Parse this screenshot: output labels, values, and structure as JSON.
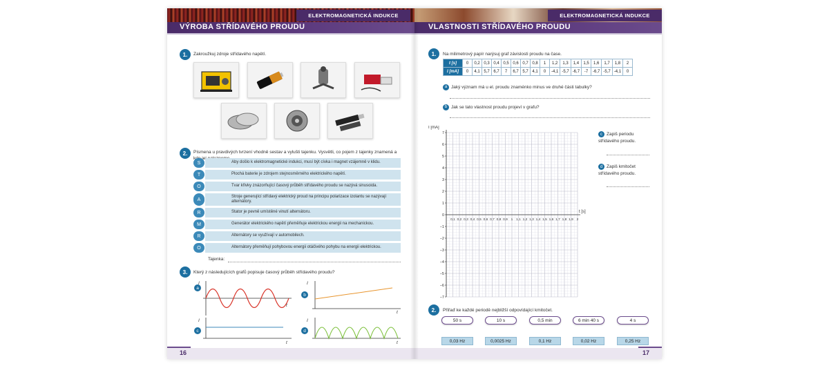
{
  "left_page": {
    "chapter": "ELEKTROMAGNETICKÁ INDUKCE",
    "title": "VÝROBA STŘÍDAVÉHO PROUDU",
    "page_number": "16",
    "task1": {
      "number": "1.",
      "text": "Zakroužkuj zdroje střídavého napětí."
    },
    "task1_photos": [
      "generator-icon",
      "battery-icon",
      "dynamo-icon",
      "power-bank-icon",
      "button-cell-icon",
      "alternator-icon",
      "usb-sticks-icon"
    ],
    "task2": {
      "number": "2.",
      "text": "Písmena u pravdivých tvrzení vhodně sestav a vylušti tajenku. Vysvětli, co pojem z tajenky znamená a kde jej nalezneme."
    },
    "statements": [
      {
        "letter": "S",
        "text": "Aby došlo k elektromagnetické indukci, musí být cívka i magnet vzájemně v klidu."
      },
      {
        "letter": "T",
        "text": "Plochá baterie je zdrojem stejnosměrného elektrického napětí."
      },
      {
        "letter": "O",
        "text": "Tvar křivky znázorňující časový průběh střídavého proudu se nazývá sinusoida."
      },
      {
        "letter": "A",
        "text": "Stroje generující střídavý elektrický proud na principu polarizace izolantu se nazývají alternátory."
      },
      {
        "letter": "R",
        "text": "Stator je pevně umístěné vinutí alternátoru."
      },
      {
        "letter": "M",
        "text": "Generátor elektrického napětí přeměňuje elektrickou energii na mechanickou."
      },
      {
        "letter": "R",
        "text": "Alternátory se využívají v automobilech."
      },
      {
        "letter": "O",
        "text": "Alternátory přeměňují pohybovou energii otáčivého pohybu na energii elektrickou."
      }
    ],
    "tajenka_label": "Tajenka:",
    "task3": {
      "number": "3.",
      "text": "Který z následujících grafů popisuje časový průběh střídavého proudu?"
    },
    "graphs": [
      {
        "label": "a",
        "ylabel": "I",
        "xlabel": "t"
      },
      {
        "label": "b",
        "ylabel": "I",
        "xlabel": "t"
      },
      {
        "label": "c",
        "ylabel": "I",
        "xlabel": "t"
      },
      {
        "label": "d",
        "ylabel": "I",
        "xlabel": "t"
      }
    ]
  },
  "right_page": {
    "chapter": "ELEKTROMAGNETICKÁ INDUKCE",
    "title": "VLASTNOSTI STŘÍDAVÉHO PROUDU",
    "page_number": "17",
    "task1": {
      "number": "1.",
      "text": "Na milimetrový papír narýsuj graf závislosti proudu na čase."
    },
    "table": {
      "t_header": "t [s]",
      "i_header": "I [mA]",
      "t_values": [
        "0",
        "0,2",
        "0,3",
        "0,4",
        "0,5",
        "0,6",
        "0,7",
        "0,8",
        "1",
        "1,2",
        "1,3",
        "1,4",
        "1,5",
        "1,6",
        "1,7",
        "1,8",
        "2"
      ],
      "i_values": [
        "0",
        "4,1",
        "5,7",
        "6,7",
        "7",
        "6,7",
        "5,7",
        "4,1",
        "0",
        "-4,1",
        "-5,7",
        "-6,7",
        "-7",
        "-6,7",
        "-5,7",
        "-4,1",
        "0"
      ]
    },
    "q_a": {
      "label": "a",
      "text": "Jaký význam má u el. proudu znaménko minus ve druhé části tabulky?"
    },
    "q_b": {
      "label": "b",
      "text": "Jak se tato vlastnost proudu projeví v grafu?"
    },
    "q_c": {
      "label": "c",
      "text": "Zapiš periodu střídavého proudu."
    },
    "q_d": {
      "label": "d",
      "text": "Zapiš kmitočet střídavého proudu."
    },
    "graph": {
      "ylabel": "I [mA]",
      "xlabel": "t [s]",
      "y_ticks": [
        "7",
        "6",
        "5",
        "4",
        "3",
        "2",
        "1",
        "0",
        "−1",
        "−2",
        "−3",
        "−4",
        "−5",
        "−6",
        "−7"
      ],
      "x_ticks": [
        "0,1",
        "0,2",
        "0,3",
        "0,4",
        "0,5",
        "0,6",
        "0,7",
        "0,8",
        "0,9",
        "1",
        "1,1",
        "1,2",
        "1,3",
        "1,4",
        "1,5",
        "1,6",
        "1,7",
        "1,8",
        "1,9",
        "2"
      ]
    },
    "task2": {
      "number": "2.",
      "text": "Přiřaď ke každé periodě nejbližší odpovídající kmitočet."
    },
    "periods": [
      "50 s",
      "10 s",
      "0,5 min",
      "6 min 40 s",
      "4 s"
    ],
    "frequencies": [
      "0,03 Hz",
      "0,0025 Hz",
      "0,1 Hz",
      "0,02 Hz",
      "0,25 Hz"
    ]
  }
}
